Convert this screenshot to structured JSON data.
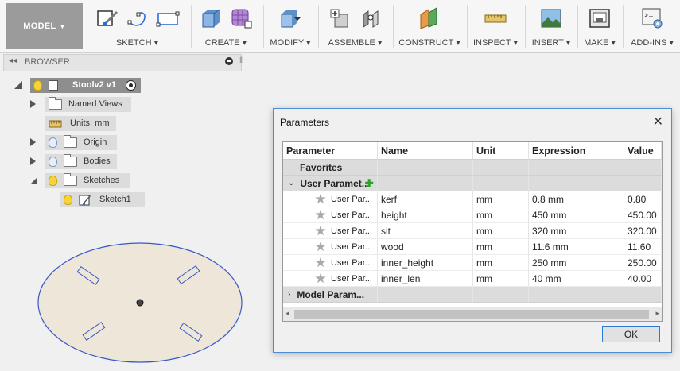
{
  "toolbar": {
    "model_label": "MODEL",
    "groups": [
      {
        "label": "SKETCH"
      },
      {
        "label": "CREATE"
      },
      {
        "label": "MODIFY"
      },
      {
        "label": "ASSEMBLE"
      },
      {
        "label": "CONSTRUCT"
      },
      {
        "label": "INSPECT"
      },
      {
        "label": "INSERT"
      },
      {
        "label": "MAKE"
      },
      {
        "label": "ADD-INS"
      }
    ]
  },
  "browser": {
    "title": "BROWSER",
    "root": "Stoolv2 v1",
    "items": [
      {
        "label": "Named Views"
      },
      {
        "label": "Units: mm"
      },
      {
        "label": "Origin"
      },
      {
        "label": "Bodies"
      },
      {
        "label": "Sketches"
      },
      {
        "label": "Sketch1"
      }
    ]
  },
  "dialog": {
    "title": "Parameters",
    "columns": [
      "Parameter",
      "Name",
      "Unit",
      "Expression",
      "Value"
    ],
    "favorites_label": "Favorites",
    "user_group_label": "User Paramet...",
    "model_group_label": "Model Param...",
    "rows": [
      {
        "param": "User Par...",
        "name": "kerf",
        "unit": "mm",
        "expr": "0.8 mm",
        "value": "0.80"
      },
      {
        "param": "User Par...",
        "name": "height",
        "unit": "mm",
        "expr": "450 mm",
        "value": "450.00"
      },
      {
        "param": "User Par...",
        "name": "sit",
        "unit": "mm",
        "expr": "320 mm",
        "value": "320.00"
      },
      {
        "param": "User Par...",
        "name": "wood",
        "unit": "mm",
        "expr": "11.6 mm",
        "value": "11.60"
      },
      {
        "param": "User Par...",
        "name": "inner_height",
        "unit": "mm",
        "expr": "250 mm",
        "value": "250.00"
      },
      {
        "param": "User Par...",
        "name": "inner_len",
        "unit": "mm",
        "expr": "40 mm",
        "value": "40.00"
      }
    ],
    "ok_label": "OK"
  },
  "colors": {
    "accent": "#4f8bd6",
    "sketch_fill": "#efe6da",
    "sketch_stroke": "#3559c7"
  }
}
